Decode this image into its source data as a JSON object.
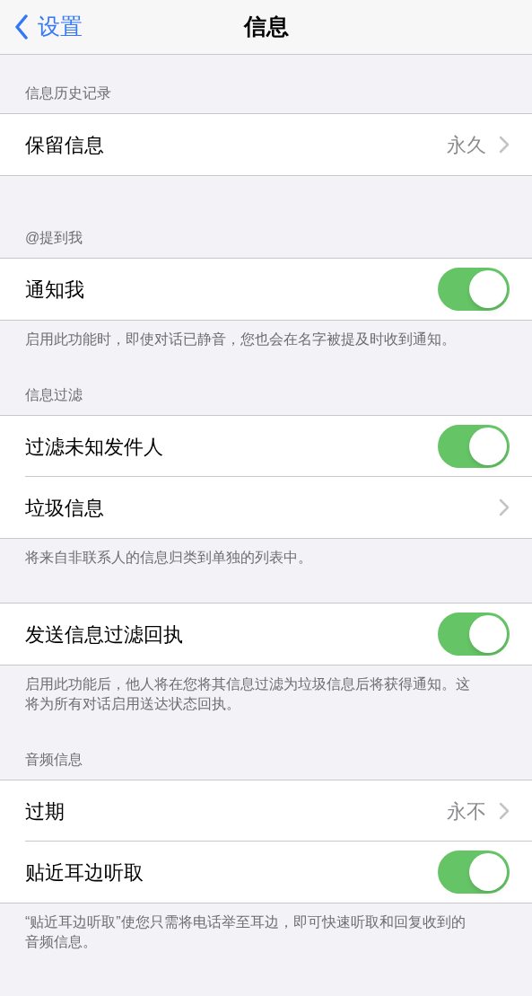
{
  "nav": {
    "back": "设置",
    "title": "信息"
  },
  "sections": [
    {
      "header": "信息历史记录",
      "rows": [
        {
          "kind": "link",
          "label": "保留信息",
          "value": "永久"
        }
      ]
    },
    {
      "header": "@提到我",
      "rows": [
        {
          "kind": "toggle",
          "label": "通知我",
          "on": true
        }
      ],
      "footer": "启用此功能时，即使对话已静音，您也会在名字被提及时收到通知。"
    },
    {
      "header": "信息过滤",
      "rows": [
        {
          "kind": "toggle",
          "label": "过滤未知发件人",
          "on": true
        },
        {
          "kind": "link",
          "label": "垃圾信息"
        }
      ],
      "footer": "将来自非联系人的信息归类到单独的列表中。"
    },
    {
      "rows": [
        {
          "kind": "toggle",
          "label": "发送信息过滤回执",
          "on": true
        }
      ],
      "footer": "启用此功能后，他人将在您将其信息过滤为垃圾信息后将获得通知。这将为所有对话启用送达状态回执。"
    },
    {
      "header": "音频信息",
      "rows": [
        {
          "kind": "link",
          "label": "过期",
          "value": "永不"
        },
        {
          "kind": "toggle",
          "label": "贴近耳边听取",
          "on": true
        }
      ],
      "footer": "“贴近耳边听取”使您只需将电话举至耳边，即可快速听取和回复收到的音频信息。"
    }
  ]
}
